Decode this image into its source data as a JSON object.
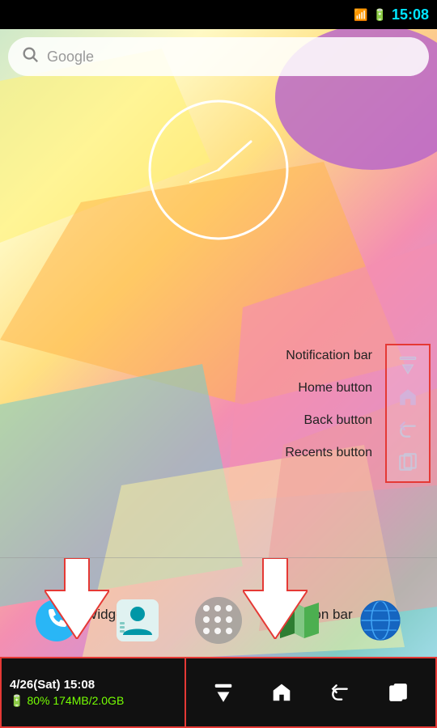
{
  "status_bar": {
    "time": "15:08",
    "wifi_icon": "wifi",
    "battery_icon": "battery"
  },
  "search": {
    "placeholder": "Google",
    "icon": "search-icon"
  },
  "clock": {
    "label": "clock-widget"
  },
  "labels": {
    "notification_bar": "Notification bar",
    "home_button": "Home button",
    "back_button": "Back button",
    "recents_button": "Recents button"
  },
  "bottom_labels": {
    "widget": "Widget",
    "navigation_bar": "Navigation bar"
  },
  "bottom_bar": {
    "date": "4/26(Sat) 15:08",
    "battery_info": "80% 174MB/2.0GB",
    "nav_buttons": [
      "notification",
      "home",
      "back",
      "recents"
    ]
  },
  "sidebar_icons": [
    "notification-down-icon",
    "home-icon",
    "back-icon",
    "recents-icon"
  ]
}
